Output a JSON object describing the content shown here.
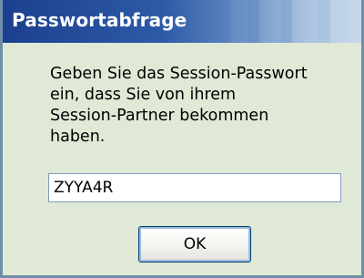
{
  "window": {
    "title": "Passwortabfrage"
  },
  "message": {
    "lines": [
      "Geben Sie das Session-Passwort",
      "ein, dass Sie von ihrem",
      "Session-Partner bekommen",
      "haben."
    ]
  },
  "password_field": {
    "value": "ZYYA4R"
  },
  "buttons": {
    "ok_label": "OK"
  },
  "colors": {
    "titlebar_start": "#1c3f8f",
    "titlebar_end": "#bcd0e8",
    "dialog_background": "#dfe9d6",
    "window_border": "#6f8fa8"
  }
}
